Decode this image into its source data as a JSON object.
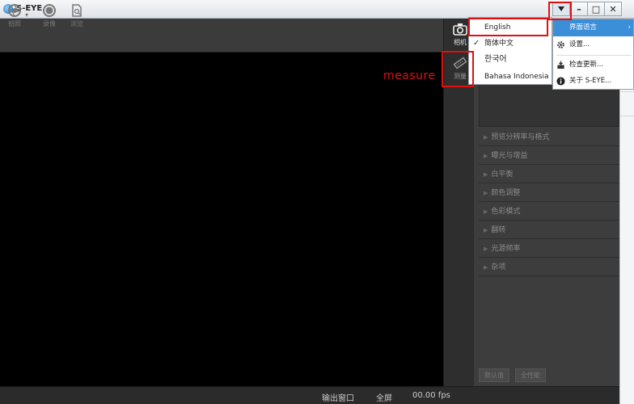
{
  "window": {
    "title": "S-EYE",
    "buttons": {
      "dropdown": "▾",
      "minimize": "–",
      "maximize": "□",
      "close": "✕"
    }
  },
  "toolbar": {
    "items": [
      {
        "label": "拍照",
        "icon": "aperture-icon"
      },
      {
        "label": "录像",
        "icon": "record-icon"
      },
      {
        "label": "浏览",
        "icon": "browse-icon"
      }
    ]
  },
  "side_tabs": [
    {
      "label": "相机",
      "icon": "camera-icon"
    },
    {
      "label": "测量",
      "icon": "ruler-icon"
    }
  ],
  "annotation": {
    "label": "measure"
  },
  "language_menu": {
    "items": [
      {
        "label": "English",
        "checked": false,
        "highlighted": true
      },
      {
        "label": "简体中文",
        "checked": true
      },
      {
        "label": "한국어",
        "checked": false
      },
      {
        "label": "Bahasa Indonesia",
        "checked": false
      }
    ],
    "check_glyph": "✓"
  },
  "settings_menu": {
    "items": [
      {
        "label": "界面语言",
        "icon": "",
        "active": true,
        "arrow": "›"
      },
      {
        "label": "设置...",
        "icon": "gear-icon"
      },
      {
        "label": "检查更新...",
        "icon": "update-icon"
      },
      {
        "label": "关于 S-EYE...",
        "icon": "info-icon"
      }
    ]
  },
  "panel": {
    "sections": [
      "预览分辨率与格式",
      "曝光与增益",
      "白平衡",
      "颜色调整",
      "色彩模式",
      "翻转",
      "光源频率",
      "杂项"
    ],
    "bottom_buttons": [
      "默认值",
      "全性能"
    ]
  },
  "status": {
    "output_window": "输出窗口",
    "fullscreen": "全屏",
    "fps": "00.00 fps"
  },
  "colors": {
    "highlight": "#3b8fd8",
    "annotation": "#e01010",
    "panel_bg": "#3d3d3d",
    "preview_bg": "#000000"
  }
}
